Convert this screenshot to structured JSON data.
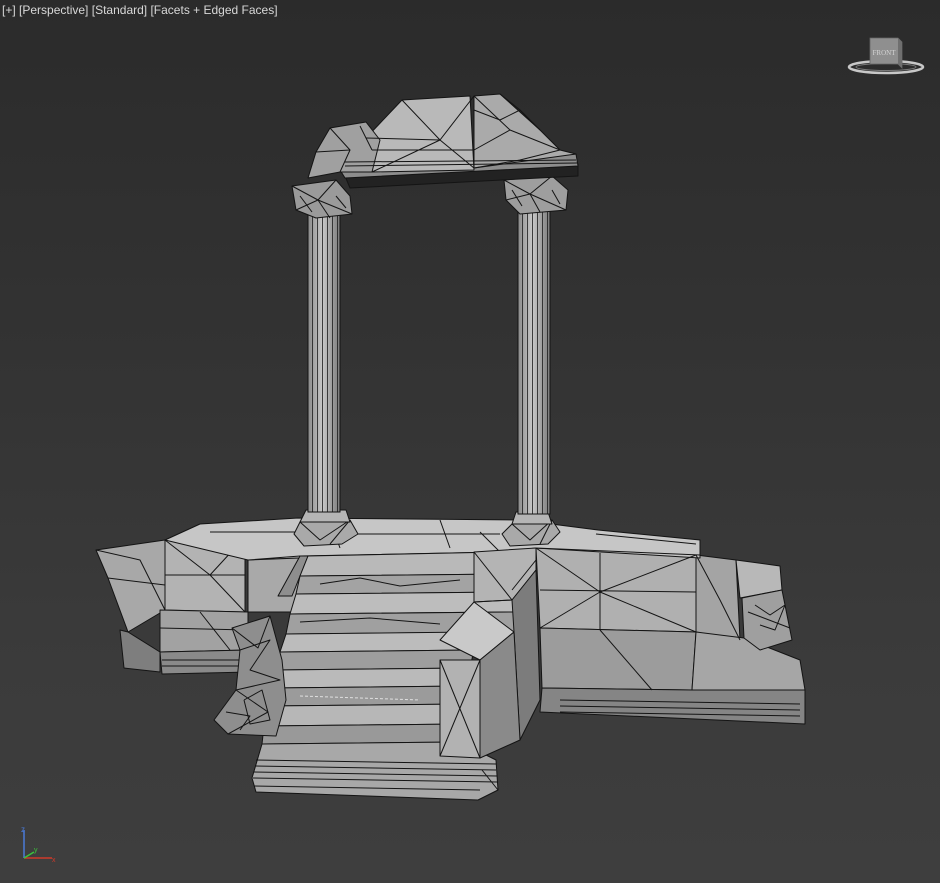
{
  "viewport": {
    "label": {
      "plus_menu": "[+]",
      "view": "[Perspective]",
      "shading": "[Standard]",
      "display_mode": "[Facets + Edged Faces]"
    },
    "viewcube": {
      "face_label": "FRONT"
    },
    "axis_tripod": {
      "z": "z",
      "y": "y",
      "x": "x"
    }
  },
  "colors": {
    "background_top": "#2b2b2b",
    "background_bottom": "#3e3e3e",
    "mesh_fill_light": "#b4b4b4",
    "mesh_fill_mid": "#9a9a9a",
    "mesh_fill_dark": "#6e6e6e",
    "wire_edges": "#141414",
    "label_text": "#d8d8d8",
    "axis_x": "#d03a2a",
    "axis_y": "#3cc43c",
    "axis_z": "#4a7ad8"
  },
  "scene": {
    "object": "ruined-temple-arch-mesh"
  }
}
